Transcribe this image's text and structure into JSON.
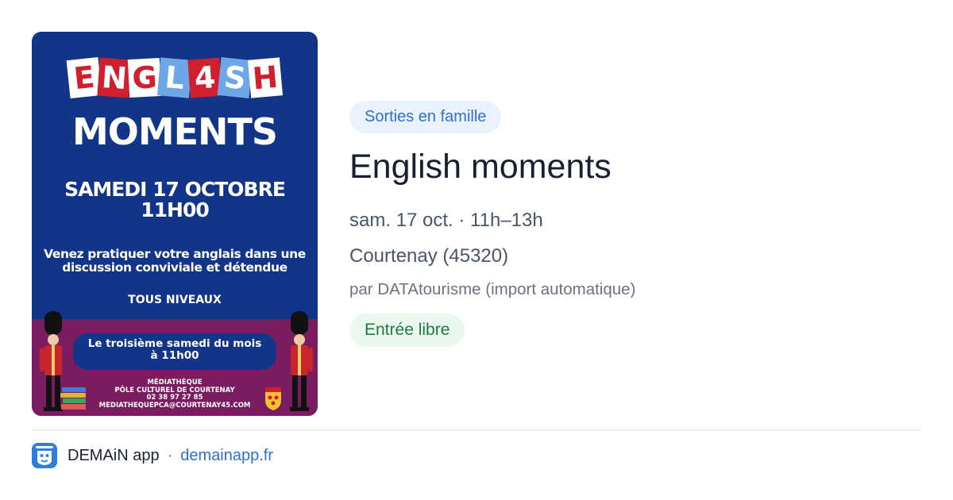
{
  "poster": {
    "title_tiles": [
      {
        "char": "E",
        "bg": "#ffffff",
        "fg": "#d21f2e"
      },
      {
        "char": "N",
        "bg": "#d21f2e",
        "fg": "#ffffff"
      },
      {
        "char": "G",
        "bg": "#ffffff",
        "fg": "#d21f2e"
      },
      {
        "char": "L",
        "bg": "#6fa7e6",
        "fg": "#ffffff"
      },
      {
        "char": "4",
        "bg": "#d21f2e",
        "fg": "#ffffff"
      },
      {
        "char": "S",
        "bg": "#6fa7e6",
        "fg": "#ffffff"
      },
      {
        "char": "H",
        "bg": "#ffffff",
        "fg": "#d21f2e"
      }
    ],
    "subtitle": "MOMENTS",
    "date_line1": "SAMEDI 17 OCTOBRE",
    "date_line2": "11H00",
    "pitch_line1": "Venez pratiquer votre anglais dans une",
    "pitch_line2": "discussion conviviale et détendue",
    "levels": "TOUS NIVEAUX",
    "pill_line1": "Le troisième samedi du mois",
    "pill_line2": "à 11h00",
    "venue_line1": "MÉDIATHÈQUE",
    "venue_line2": "PÔLE CULTUREL DE COURTENAY",
    "venue_line3": "02 38 97 27 85",
    "venue_line4": "MEDIATHEQUEPCA@COURTENAY45.COM",
    "colors": {
      "top": "#12358a",
      "bottom": "#7a1c5f"
    }
  },
  "event": {
    "category": "Sorties en famille",
    "title": "English moments",
    "when": "sam. 17 oct. · 11h–13h",
    "where": "Courtenay (45320)",
    "source": "par DATAtourisme (import automatique)",
    "price": "Entrée libre"
  },
  "footer": {
    "app_name": "DEMAiN app",
    "separator": "·",
    "site": "demainapp.fr"
  },
  "colors": {
    "accent_blue": "#2f6fd0",
    "tag_bg": "#eaf2fd",
    "price_green": "#207a3e",
    "price_bg": "#ebf8ef"
  }
}
